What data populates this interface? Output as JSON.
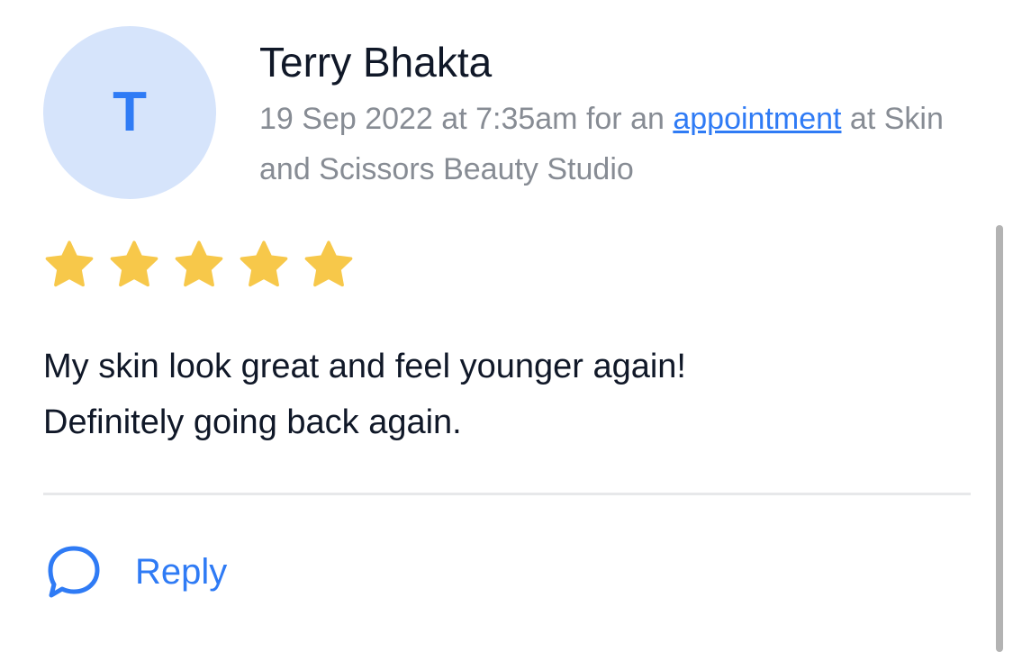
{
  "review": {
    "avatar_initial": "T",
    "reviewer_name": "Terry Bhakta",
    "meta_prefix": "19 Sep 2022 at 7:35am for an ",
    "meta_link": "appointment",
    "meta_suffix": " at Skin and Scissors Beauty Studio",
    "rating": 5,
    "rating_max": 5,
    "text_line1": "My skin look great and feel younger again!",
    "text_line2": "Definitely going back again."
  },
  "actions": {
    "reply_label": "Reply"
  },
  "colors": {
    "accent": "#2f7bf5",
    "avatar_bg": "#d6e4fb",
    "star": "#f7c84a",
    "meta_text": "#878c94",
    "body_text": "#101828"
  },
  "icons": {
    "star": "star-icon",
    "reply": "speech-bubble-icon"
  }
}
